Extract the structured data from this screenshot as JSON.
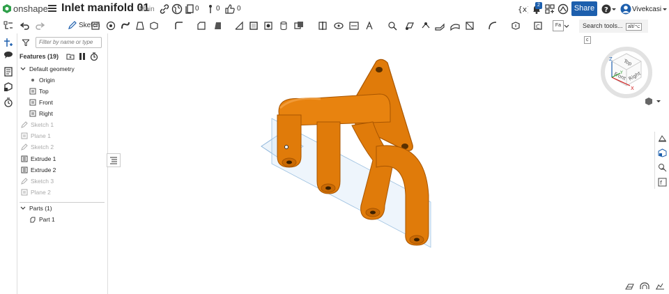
{
  "header": {
    "brand": "onshape",
    "doc_title": "Inlet manifold 01",
    "branch": "Main",
    "versions_count": "0",
    "branches_count": "0",
    "likes_count": "0",
    "notification_count": "2",
    "share_label": "Share",
    "user_name": "Vivekcasi",
    "icons": [
      "hamburger-icon",
      "link-icon",
      "globe-icon",
      "versions-icon",
      "branch-icon",
      "like-icon",
      "variables-icon",
      "bell-icon",
      "apps-icon",
      "learning-icon",
      "help-icon",
      "user-avatar-icon"
    ]
  },
  "toolbar": {
    "sketch_label": "Sketch",
    "search_label": "Search tools...",
    "shortcut_key1": "alt/⌥",
    "shortcut_key2": "c",
    "fa_label": "Fa"
  },
  "feature_panel": {
    "filter_placeholder": "Filter by name or type",
    "features_header": "Features (19)",
    "default_geometry_label": "Default geometry",
    "default_items": [
      {
        "label": "Origin",
        "icon": "origin-icon"
      },
      {
        "label": "Top",
        "icon": "plane-icon"
      },
      {
        "label": "Front",
        "icon": "plane-icon"
      },
      {
        "label": "Right",
        "icon": "plane-icon"
      }
    ],
    "features": [
      {
        "label": "Sketch 1",
        "dim": true,
        "icon": "sketch-icon"
      },
      {
        "label": "Plane 1",
        "dim": true,
        "icon": "plane-icon"
      },
      {
        "label": "Sketch 2",
        "dim": true,
        "icon": "sketch-icon"
      },
      {
        "label": "Extrude 1",
        "dim": false,
        "icon": "extrude-icon"
      },
      {
        "label": "Extrude 2",
        "dim": false,
        "icon": "extrude-icon"
      },
      {
        "label": "Sketch 3",
        "dim": true,
        "icon": "sketch-icon"
      },
      {
        "label": "Plane 2",
        "dim": true,
        "icon": "plane-icon"
      }
    ],
    "parts_header": "Parts (1)",
    "parts": [
      {
        "label": "Part 1",
        "icon": "part-icon"
      }
    ]
  },
  "viewcube": {
    "face_top": "Top",
    "face_front": "Front",
    "face_right": "Right",
    "axis_x": "X",
    "axis_y": "Y",
    "axis_z": "Z"
  },
  "colors": {
    "accent": "#1d5fad",
    "part": "#e07b0a",
    "part_dark": "#a85500",
    "plane": "#cfe3f5"
  }
}
